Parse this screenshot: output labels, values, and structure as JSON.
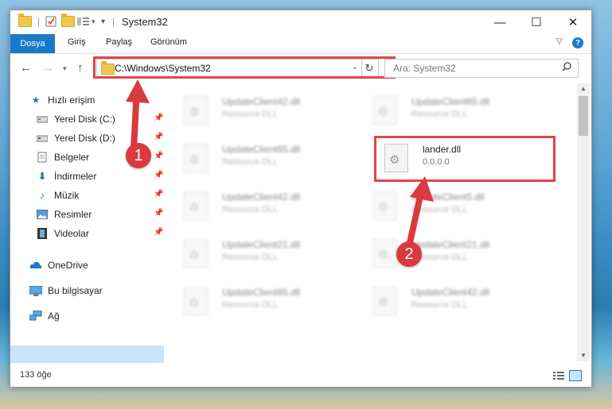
{
  "window": {
    "title": "System32"
  },
  "ribbon": {
    "tabs": [
      "Dosya",
      "Giriş",
      "Paylaş",
      "Görünüm"
    ]
  },
  "address": {
    "path": "C:\\Windows\\System32"
  },
  "search": {
    "placeholder": "Ara: System32"
  },
  "sidebar": {
    "items": [
      {
        "label": "Hızlı erişim",
        "icon": "star-icon"
      },
      {
        "label": "Yerel Disk (C:)",
        "icon": "drive-icon"
      },
      {
        "label": "Yerel Disk (D:)",
        "icon": "drive-icon"
      },
      {
        "label": "Belgeler",
        "icon": "documents-icon"
      },
      {
        "label": "İndirmeler",
        "icon": "download-icon"
      },
      {
        "label": "Müzik",
        "icon": "music-icon"
      },
      {
        "label": "Resimler",
        "icon": "pictures-icon"
      },
      {
        "label": "Videolar",
        "icon": "video-icon"
      },
      {
        "label": "OneDrive",
        "icon": "cloud-icon"
      },
      {
        "label": "Bu bilgisayar",
        "icon": "computer-icon"
      },
      {
        "label": "Ağ",
        "icon": "network-icon"
      }
    ]
  },
  "files": [
    {
      "name": "UpdateClient42.dll",
      "type": "Resource DLL"
    },
    {
      "name": "UpdateClient65.dll",
      "type": "Resource DLL"
    },
    {
      "name": "UpdateClient65.dll",
      "type": "Resource DLL"
    },
    {
      "name": "lander.dll",
      "type": "0.0.0.0"
    },
    {
      "name": "UpdateClient42.dll",
      "type": "Resource DLL"
    },
    {
      "name": "UpdateClient5.dll",
      "type": "Resource DLL"
    },
    {
      "name": "UpdateClient21.dll",
      "type": "Resource DLL"
    },
    {
      "name": "UpdateClient21.dll",
      "type": "Resource DLL"
    },
    {
      "name": "UpdateClient65.dll",
      "type": "Resource DLL"
    },
    {
      "name": "UpdateClient42.dll",
      "type": "Resource DLL"
    }
  ],
  "status": {
    "count": "133 öğe"
  },
  "annotations": {
    "badge1": "1",
    "badge2": "2"
  },
  "colors": {
    "accent": "#1979ca",
    "highlight": "#e0454b",
    "selection": "#cce4f7"
  }
}
